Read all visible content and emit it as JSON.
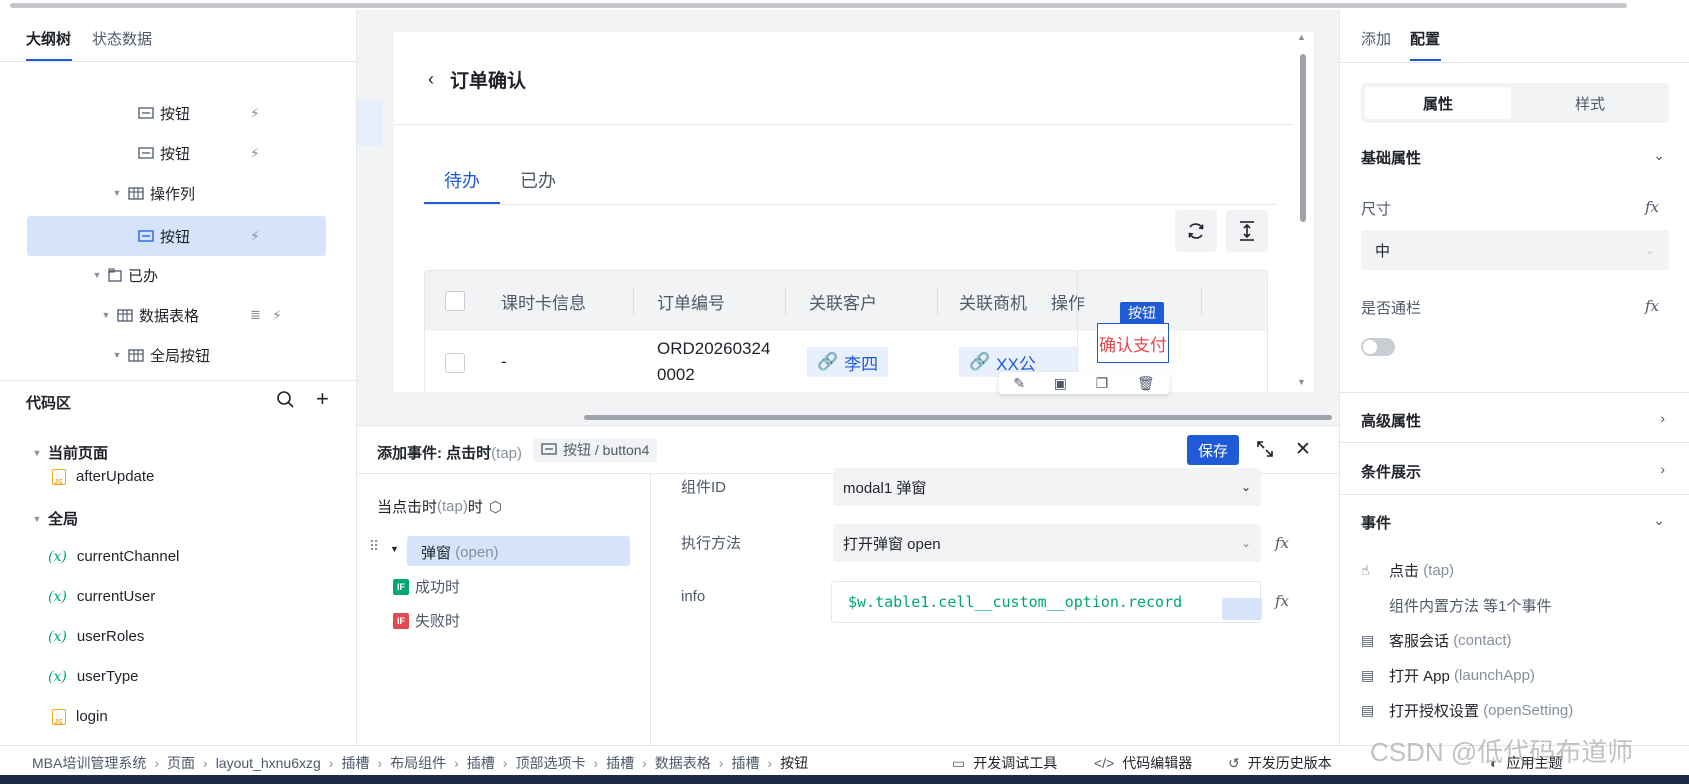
{
  "left_panel": {
    "tabs": [
      "大纲树",
      "状态数据"
    ],
    "tree": [
      {
        "label": "按钮"
      },
      {
        "label": "按钮"
      },
      {
        "label": "操作列"
      },
      {
        "label": "按钮"
      },
      {
        "label": "已办"
      },
      {
        "label": "数据表格"
      },
      {
        "label": "全局按钮"
      }
    ],
    "code": {
      "title": "代码区",
      "current_page": "当前页面",
      "after_update": "afterUpdate",
      "global": "全局",
      "vars": [
        "currentChannel",
        "currentUser",
        "userRoles",
        "userType"
      ],
      "login": "login",
      "var_symbol": "(x)"
    }
  },
  "canvas": {
    "title": "订单确认",
    "tabs": [
      "待办",
      "已办"
    ],
    "columns": [
      "课时卡信息",
      "订单编号",
      "关联客户",
      "关联商机",
      "操作"
    ],
    "row": {
      "card": "-",
      "order_line1": "ORD20260324",
      "order_line2": "0002",
      "customer": "李四",
      "opportunity": "XX公",
      "action": "确认支付"
    },
    "selected_label": "按钮"
  },
  "event_panel": {
    "title_prefix": "添加事件: 点击时",
    "title_code": "(tap)",
    "chip": "按钮 / button4",
    "save": "保存",
    "trigger": "当点击时",
    "trigger_code": "(tap)",
    "trigger_suffix": "时",
    "action": "弹窗",
    "action_code": "(open)",
    "success": "成功时",
    "fail": "失败时",
    "if_tag": "IF",
    "field_component_id": "组件ID",
    "component_value": "modal1 弹窗",
    "field_method": "执行方法",
    "method_value": "打开弹窗 open",
    "field_info": "info",
    "info_value": "$w.table1.cell__custom__option.record"
  },
  "right_panel": {
    "tabs": [
      "添加",
      "配置"
    ],
    "segments": [
      "属性",
      "样式"
    ],
    "basic": "基础属性",
    "size_label": "尺寸",
    "size_value": "中",
    "full_width_label": "是否通栏",
    "advanced": "高级属性",
    "conditional": "条件展示",
    "events": "事件",
    "event_click": "点击",
    "event_click_code": "(tap)",
    "event_click_sub": "组件内置方法 等1个事件",
    "event_contact": "客服会话",
    "event_contact_code": "(contact)",
    "event_launch": "打开 App",
    "event_launch_code": "(launchApp)",
    "event_setting": "打开授权设置",
    "event_setting_code": "(openSetting)",
    "fx": "fx"
  },
  "bottom_bar": {
    "breadcrumb": [
      "MBA培训管理系统",
      "页面",
      "layout_hxnu6xzg",
      "插槽",
      "布局组件",
      "插槽",
      "顶部选项卡",
      "插槽",
      "数据表格",
      "插槽",
      "按钮"
    ],
    "tools": [
      "开发调试工具",
      "代码编辑器",
      "开发历史版本",
      "应用主题"
    ]
  },
  "watermark": "CSDN @低代码布道师",
  "colors": {
    "accent": "#1f5bd6",
    "danger": "#e5484d",
    "success": "#00a870",
    "warning": "#f5a623"
  }
}
